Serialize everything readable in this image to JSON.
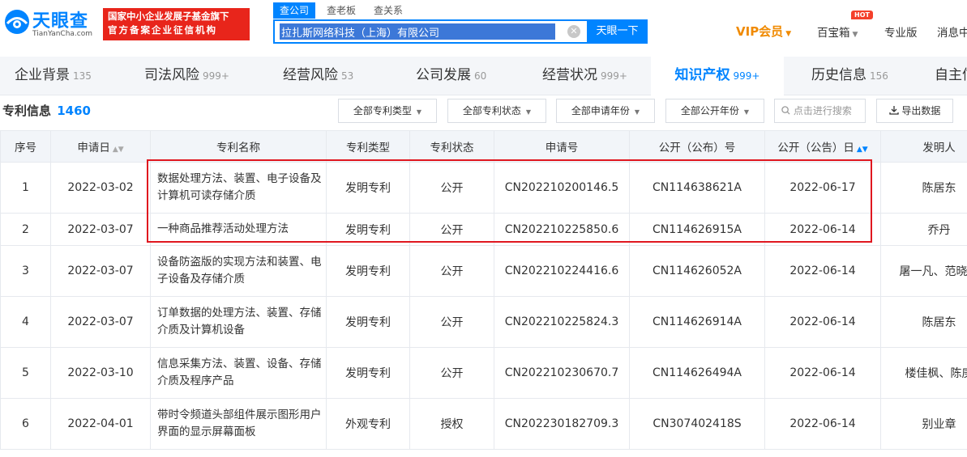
{
  "header": {
    "logo_text": "天眼查",
    "logo_domain": "TianYanCha.com",
    "banner_line1": "国家中小企业发展子基金旗下",
    "banner_line2": "官方备案企业征信机构",
    "search_tabs": [
      "查公司",
      "查老板",
      "查关系"
    ],
    "search_value": "拉扎斯网络科技（上海）有限公司",
    "search_button": "天眼一下",
    "vip_label": "VIP会员",
    "treasure_label": "百宝箱",
    "hot_badge": "HOT",
    "pro_label": "专业版",
    "messages_label": "消息中"
  },
  "category_tabs": [
    {
      "label": "企业背景",
      "count": "135"
    },
    {
      "label": "司法风险",
      "count": "999+"
    },
    {
      "label": "经营风险",
      "count": "53"
    },
    {
      "label": "公司发展",
      "count": "60"
    },
    {
      "label": "经营状况",
      "count": "999+"
    },
    {
      "label": "知识产权",
      "count": "999+",
      "active": true
    },
    {
      "label": "历史信息",
      "count": "156"
    },
    {
      "label": "自主信",
      "count": ""
    }
  ],
  "section": {
    "title": "专利信息",
    "count": "1460",
    "filters": [
      "全部专利类型",
      "全部专利状态",
      "全部申请年份",
      "全部公开年份"
    ],
    "search_placeholder": "点击进行搜索",
    "export_label": "导出数据"
  },
  "table": {
    "columns": [
      "序号",
      "申请日",
      "专利名称",
      "专利类型",
      "专利状态",
      "申请号",
      "公开（公布）号",
      "公开（公告）日",
      "发明人"
    ],
    "rows": [
      {
        "no": "1",
        "date": "2022-03-02",
        "name": "数据处理方法、装置、电子设备及计算机可读存储介质",
        "type": "发明专利",
        "status": "公开",
        "app_no": "CN202210200146.5",
        "pub_no": "CN114638621A",
        "pub_date": "2022-06-17",
        "inventor": "陈居东"
      },
      {
        "no": "2",
        "date": "2022-03-07",
        "name": "一种商品推荐活动处理方法",
        "type": "发明专利",
        "status": "公开",
        "app_no": "CN202210225850.6",
        "pub_no": "CN114626915A",
        "pub_date": "2022-06-14",
        "inventor": "乔丹"
      },
      {
        "no": "3",
        "date": "2022-03-07",
        "name": "设备防盗版的实现方法和装置、电子设备及存储介质",
        "type": "发明专利",
        "status": "公开",
        "app_no": "CN202210224416.6",
        "pub_no": "CN114626052A",
        "pub_date": "2022-06-14",
        "inventor": "屠一凡、范晓锦"
      },
      {
        "no": "4",
        "date": "2022-03-07",
        "name": "订单数据的处理方法、装置、存储介质及计算机设备",
        "type": "发明专利",
        "status": "公开",
        "app_no": "CN202210225824.3",
        "pub_no": "CN114626914A",
        "pub_date": "2022-06-14",
        "inventor": "陈居东"
      },
      {
        "no": "5",
        "date": "2022-03-10",
        "name": "信息采集方法、装置、设备、存储介质及程序产品",
        "type": "发明专利",
        "status": "公开",
        "app_no": "CN202210230670.7",
        "pub_no": "CN114626494A",
        "pub_date": "2022-06-14",
        "inventor": "楼佳枫、陈庚"
      },
      {
        "no": "6",
        "date": "2022-04-01",
        "name": "带时令频道头部组件展示图形用户界面的显示屏幕面板",
        "type": "外观专利",
        "status": "授权",
        "app_no": "CN202230182709.3",
        "pub_no": "CN307402418S",
        "pub_date": "2022-06-14",
        "inventor": "别业章"
      }
    ]
  },
  "colors": {
    "brand": "#0084ff",
    "vip": "#f08a00",
    "banner": "#e8251b",
    "status_public": "#a24cd4",
    "status_granted": "#1fa14b",
    "highlight": "#e0171f"
  }
}
